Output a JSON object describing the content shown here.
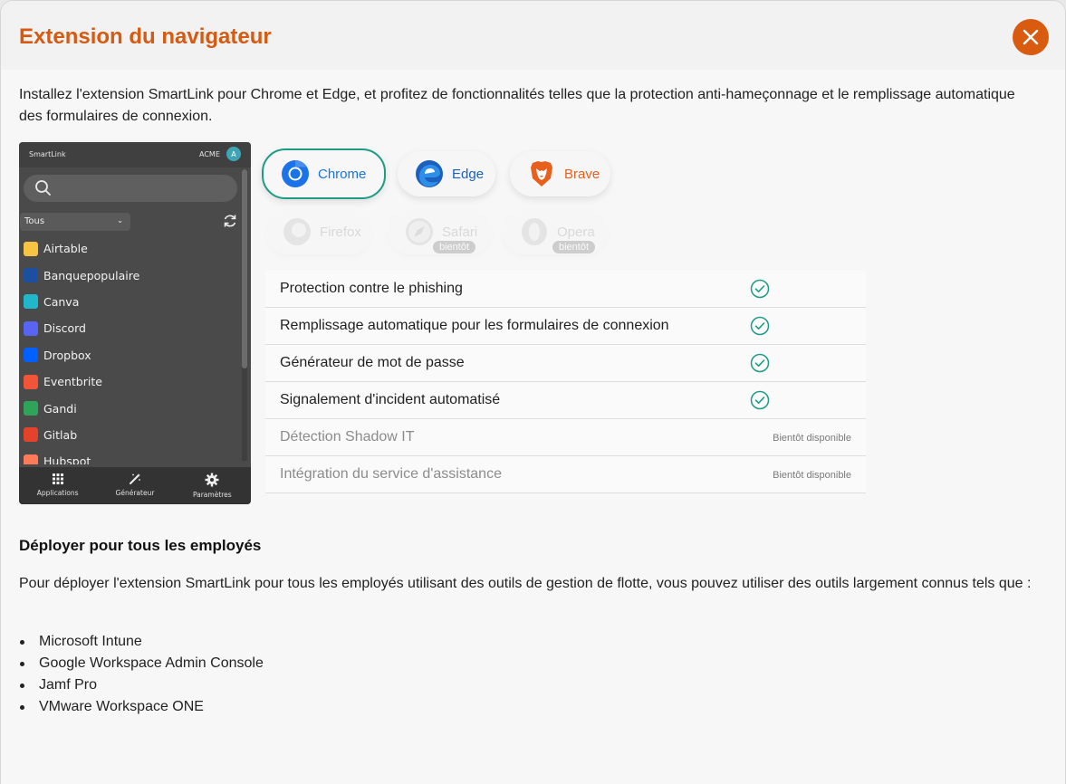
{
  "modal": {
    "title": "Extension du navigateur",
    "close_label": "close",
    "intro": "Installez l'extension SmartLink pour Chrome et Edge, et profitez de fonctionnalités telles que la protection anti-hameçonnage et le remplissage automatique des formulaires de connexion."
  },
  "extension_preview": {
    "brand": "SmartLink",
    "org": "ACME",
    "avatar_initial": "A",
    "filter": "Tous",
    "apps": [
      {
        "name": "Airtable",
        "color": "#f6c343"
      },
      {
        "name": "Banquepopulaire",
        "color": "#1d4fa0"
      },
      {
        "name": "Canva",
        "color": "#1fb7c9"
      },
      {
        "name": "Discord",
        "color": "#5865f2"
      },
      {
        "name": "Dropbox",
        "color": "#0061fe"
      },
      {
        "name": "Eventbrite",
        "color": "#f05537"
      },
      {
        "name": "Gandi",
        "color": "#2fa35a"
      },
      {
        "name": "Gitlab",
        "color": "#e2432a"
      },
      {
        "name": "Hubspot",
        "color": "#ff7a59"
      }
    ],
    "tabs": [
      "Applications",
      "Générateur",
      "Paramètres"
    ]
  },
  "browsers": [
    {
      "name": "Chrome",
      "state": "active",
      "color": "#1a73e8"
    },
    {
      "name": "Edge",
      "state": "available",
      "color": "#1b5fbf"
    },
    {
      "name": "Brave",
      "state": "available",
      "color": "#e8601c"
    },
    {
      "name": "Firefox",
      "state": "disabled"
    },
    {
      "name": "Safari",
      "state": "disabled",
      "badge": "bientôt"
    },
    {
      "name": "Opera",
      "state": "disabled",
      "badge": "bientôt"
    }
  ],
  "features": [
    {
      "label": "Protection contre le phishing",
      "status": "available"
    },
    {
      "label": "Remplissage automatique pour les formulaires de connexion",
      "status": "available"
    },
    {
      "label": "Générateur de mot de passe",
      "status": "available"
    },
    {
      "label": "Signalement d'incident automatisé",
      "status": "available"
    },
    {
      "label": "Détection Shadow IT",
      "status": "soon",
      "soon_label": "Bientôt disponible"
    },
    {
      "label": "Intégration du service d'assistance",
      "status": "soon",
      "soon_label": "Bientôt disponible"
    }
  ],
  "deploy": {
    "title": "Déployer pour tous les employés",
    "text": "Pour déployer l'extension SmartLink pour tous les employés utilisant des outils de gestion de flotte, vous pouvez utiliser des outils largement connus tels que :",
    "tools": [
      "Microsoft Intune",
      "Google Workspace Admin Console",
      "Jamf Pro",
      "VMware Workspace ONE"
    ]
  },
  "colors": {
    "accent": "#d55a12",
    "close_bg": "#d95b10",
    "check": "#1d9b84"
  }
}
